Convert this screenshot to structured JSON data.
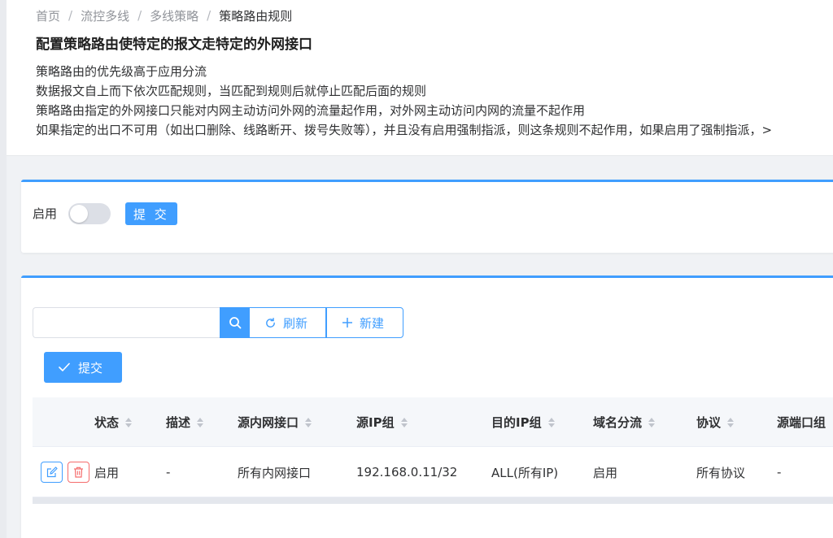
{
  "breadcrumb": [
    "首页",
    "流控多线",
    "多线策略",
    "策略路由规则"
  ],
  "page_title": "配置策略路由使特定的报文走特定的外网接口",
  "description": [
    "策略路由的优先级高于应用分流",
    "数据报文自上而下依次匹配规则，当匹配到规则后就停止匹配后面的规则",
    "策略路由指定的外网接口只能对内网主动访问外网的流量起作用，对外网主动访问内网的流量不起作用",
    "如果指定的出口不可用（如出口删除、线路断开、拨号失败等），并且没有启用强制指派，则这条规则不起作用，如果启用了强制指派，>"
  ],
  "enable_section": {
    "label": "启用",
    "switch_on": false,
    "submit_label": "提 交"
  },
  "toolbar": {
    "search_value": "",
    "refresh_label": "刷新",
    "new_label": "新建",
    "submit_label": "提交"
  },
  "table": {
    "columns": [
      "状态",
      "描述",
      "源内网接口",
      "源IP组",
      "目的IP组",
      "域名分流",
      "协议",
      "源端口组"
    ],
    "rows": [
      [
        "启用",
        "-",
        "所有内网接口",
        "192.168.0.11/32",
        "ALL(所有IP)",
        "启用",
        "所有协议",
        "-"
      ]
    ]
  },
  "colors": {
    "primary": "#409eff",
    "danger": "#f56c6c"
  }
}
